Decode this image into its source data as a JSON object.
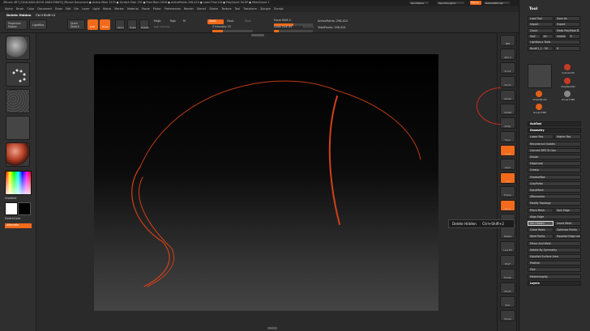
{
  "title_bar": {
    "app_text": "ZBrush 4R7 [2016-0000-DVVG-9A83-FMKFG] ZBrush Document  ● Active Mem 1275 ● Scratch Disk 170 ● Free Mem 2018 ● ActivePoints 298,424 ● Load Time 0.8 ● PolyCount 30 KP ● MeshCount 1",
    "quicksave": "QuickSave",
    "see_through": "See-through 0",
    "menus_btn": "Menus",
    "default_script": "DefaultZScript"
  },
  "menubar": [
    "Alpha",
    "Brush",
    "Color",
    "Document",
    "Draw",
    "Edit",
    "File",
    "Layer",
    "Light",
    "Macro",
    "Marker",
    "Material",
    "Movie",
    "Picker",
    "Preferences",
    "Render",
    "Stencil",
    "Stroke",
    "Texture",
    "Tool",
    "Transform",
    "Zplugin",
    "Zscript"
  ],
  "shelf": {
    "delete_hidden": "Delete Hidden",
    "shortcut": "Ctrl+Shift+2",
    "projection_master": "Projection Master",
    "lightbox": "LightBox",
    "quick_sketch": "Quick Sketch",
    "edit": "Edit",
    "draw": "Draw",
    "move": "Move",
    "scale": "Scale",
    "rotate": "Rotate",
    "mrgb": "Mrgb",
    "rgb": "Rgb",
    "m": "M",
    "rgb_intensity": "Rgb Intensity",
    "zadd": "Zadd",
    "zsub": "Zsub",
    "zcut": "Zcut",
    "z_intensity": "Z Intensity 25",
    "focal_shift": "Focal Shift 0",
    "draw_size": "Draw Size 64",
    "dynamic": "Dynamic",
    "active_points": "ActivePoints: 298,424",
    "total_points": "TotalPoints: 298,424"
  },
  "left": {
    "gradient": "Gradient",
    "switch_color": "SwitchColor",
    "alternate": "Alternate"
  },
  "right_shelf": [
    "BPR",
    "SPix 3",
    "Scroll",
    "Zoom",
    "Actual",
    "AAHalf",
    "Persp",
    "Floor",
    "Local",
    "LSym",
    "Xyz",
    "Frame",
    "Move",
    "Scale",
    "Rotate",
    "Line Fill",
    "PolyF",
    "Transp",
    "Ghost",
    "Solo",
    "Xpose"
  ],
  "tooltip": {
    "label": "Delete Hidden",
    "shortcut": "Ctrl+Shift+2"
  },
  "tool_tray": {
    "title": "Tool",
    "rows": [
      [
        "Load Tool",
        "Save As"
      ],
      [
        "Import",
        "Export"
      ],
      [
        "Clone",
        "Make PolyMesh3D"
      ],
      [
        "GoZ",
        "All",
        "Visible",
        "R"
      ],
      [
        "Lightbox ▸ Tools"
      ],
      [
        "Bust01_1 . 50",
        "R"
      ]
    ],
    "subtools": [
      "Cylinder3D",
      "PolyMesh3D",
      "SimpleBrush",
      "Group7YMR",
      "Group7YMR"
    ],
    "sections": [
      "SubTool",
      "Geometry",
      "Lower Res",
      "Higher Res",
      "Reconstruct Subdiv",
      "Convert BPR To Geo",
      "Divide",
      "EdgeLoop",
      "Crease",
      "ShadowBox",
      "ClayPolish",
      "DynaMesh",
      "ZRemesher",
      "Modify Topology",
      "Micro Mesh",
      "Spin Edge",
      "Align Edge",
      "Del Hidden",
      "Insert Mesh",
      "Close Holes",
      "Optimize Points",
      "Weld Points",
      "Equalize Edge Length",
      "Mirror And Weld",
      "Delete By Symmetry",
      "Equalize Surface Area",
      "Position",
      "Size",
      "MeshIntegrity",
      "Layers"
    ]
  },
  "colors": {
    "accent": "#f26a1b",
    "curve": "#d2401a",
    "bg": "#2a2a2a"
  }
}
